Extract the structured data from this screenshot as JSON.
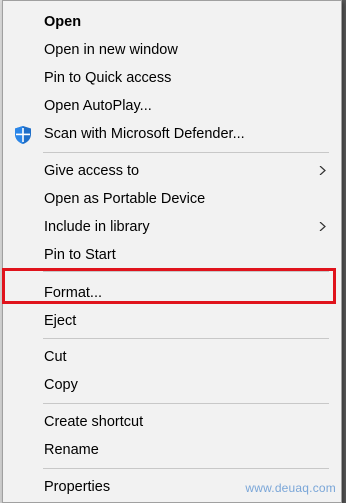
{
  "menu": {
    "open": "Open",
    "open_new_window": "Open in new window",
    "pin_quick_access": "Pin to Quick access",
    "open_autoplay": "Open AutoPlay...",
    "scan_defender": "Scan with Microsoft Defender...",
    "give_access": "Give access to",
    "open_portable": "Open as Portable Device",
    "include_library": "Include in library",
    "pin_start": "Pin to Start",
    "format": "Format...",
    "eject": "Eject",
    "cut": "Cut",
    "copy": "Copy",
    "create_shortcut": "Create shortcut",
    "rename": "Rename",
    "properties": "Properties"
  },
  "icons": {
    "defender": "shield-icon",
    "submenu": "chevron-right-icon"
  },
  "colors": {
    "highlight_border": "#e0131c",
    "menu_background": "#f2f2f2",
    "shield_blue": "#1f6fc9"
  },
  "watermark": "www.deuaq.com"
}
